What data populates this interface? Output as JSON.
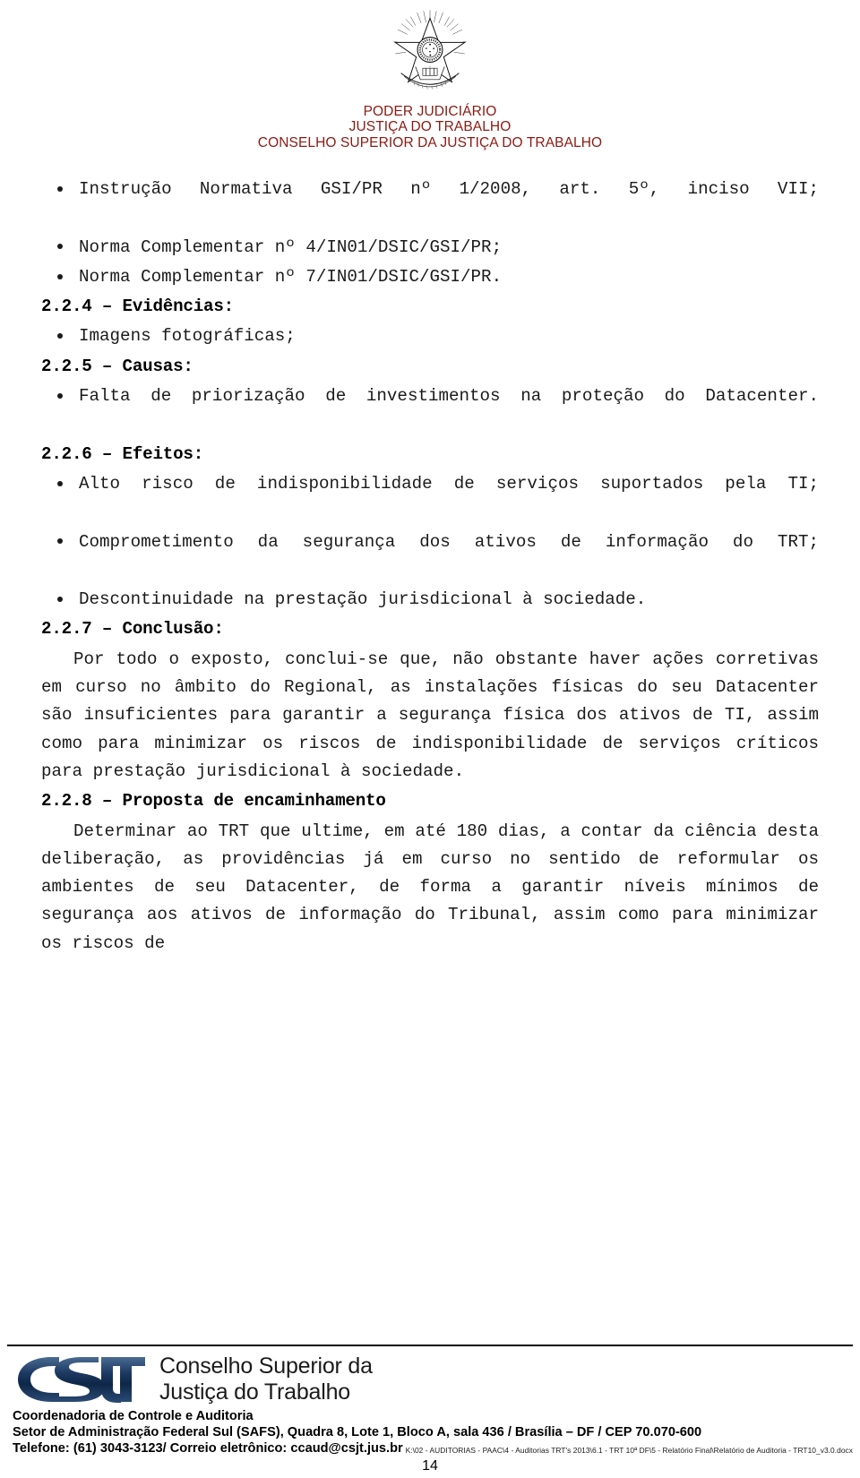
{
  "header": {
    "emblem_name": "brazil-coat-of-arms",
    "line1": "PODER JUDICIÁRIO",
    "line2": "JUSTIÇA DO TRABALHO",
    "line3": "CONSELHO SUPERIOR DA JUSTIÇA DO TRABALHO",
    "color": "#8c1a12"
  },
  "content": {
    "bullets_norms": [
      "Instrução Normativa GSI/PR nº 1/2008, art. 5º, inciso VII;",
      "Norma Complementar nº 4/IN01/DSIC/GSI/PR;",
      "Norma Complementar nº 7/IN01/DSIC/GSI/PR."
    ],
    "section_evidencias": {
      "heading": "2.2.4 – Evidências:",
      "bullets": [
        "Imagens fotográficas;"
      ]
    },
    "section_causas": {
      "heading": "2.2.5 – Causas:",
      "bullets": [
        "Falta de priorização de investimentos na proteção do Datacenter."
      ]
    },
    "section_efeitos": {
      "heading": "2.2.6 – Efeitos:",
      "bullets": [
        "Alto risco de indisponibilidade de serviços suportados pela TI;",
        "Comprometimento da segurança dos ativos de informação do TRT;",
        "Descontinuidade na prestação jurisdicional à sociedade."
      ]
    },
    "section_conclusao": {
      "heading": "2.2.7 – Conclusão:",
      "paragraph": "Por todo o exposto, conclui-se que, não obstante haver ações corretivas em curso no âmbito do Regional, as instalações físicas do seu Datacenter são insuficientes para garantir a segurança física dos ativos de TI, assim como para minimizar os riscos de indisponibilidade de serviços críticos para prestação jurisdicional à sociedade."
    },
    "section_proposta": {
      "heading": "2.2.8 – Proposta de encaminhamento",
      "paragraph": "Determinar ao TRT que ultime, em até 180 dias, a contar da ciência desta deliberação, as providências já em curso no sentido de reformular os ambientes de seu Datacenter, de forma a garantir níveis mínimos de segurança aos ativos de informação do Tribunal, assim como para minimizar os riscos de"
    }
  },
  "footer": {
    "logo_name": "csjt-logo",
    "wordmark_line1": "Conselho Superior da",
    "wordmark_line2": "Justiça do Trabalho",
    "address_line1": "Coordenadoria de Controle e Auditoria",
    "address_line2": "Setor de Administração Federal Sul (SAFS), Quadra 8, Lote 1, Bloco A, sala 436 / Brasília – DF / CEP 70.070-600",
    "address_line3": "Telefone: (61) 3043-3123/  Correio eletrônico: ccaud@csjt.jus.br",
    "file_path": "K:\\02 - AUDITORIAS - PAAC\\4 - Auditorias TRT's 2013\\6.1 - TRT 10ª DF\\5 - Relatório Final\\Relatório de Auditoria - TRT10_v3.0.docx",
    "page_number": "14"
  }
}
